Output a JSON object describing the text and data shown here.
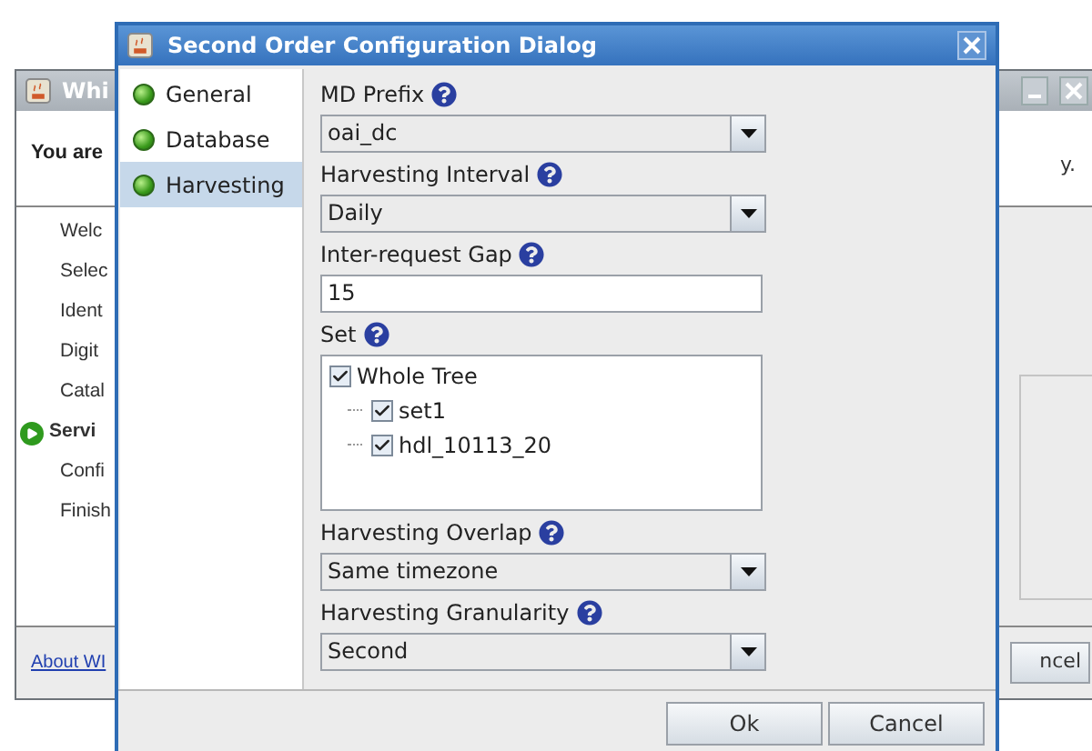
{
  "background_window": {
    "title": "Whi",
    "heading": "You are",
    "steps": [
      {
        "label": "Welc",
        "current": false
      },
      {
        "label": "Selec",
        "current": false
      },
      {
        "label": "Ident",
        "current": false
      },
      {
        "label": "Digit",
        "current": false
      },
      {
        "label": "Catal",
        "current": false
      },
      {
        "label": "Servi",
        "current": true
      },
      {
        "label": "Confi",
        "current": false
      },
      {
        "label": "Finish",
        "current": false
      }
    ],
    "trailing_text": "y.",
    "link": "About WI",
    "button": "ncel"
  },
  "dialog": {
    "title": "Second Order Configuration Dialog",
    "nav": [
      {
        "label": "General",
        "selected": false
      },
      {
        "label": "Database",
        "selected": false
      },
      {
        "label": "Harvesting",
        "selected": true
      }
    ],
    "fields": [
      {
        "kind": "dropdown",
        "label": "MD Prefix",
        "value": "oai_dc"
      },
      {
        "kind": "dropdown",
        "label": "Harvesting Interval",
        "value": "Daily"
      },
      {
        "kind": "text",
        "label": "Inter-request Gap",
        "value": "15"
      },
      {
        "kind": "tree",
        "label": "Set",
        "tree": [
          {
            "label": "Whole Tree",
            "checked": true,
            "children": [
              {
                "label": "set1",
                "checked": true
              },
              {
                "label": "hdl_10113_20",
                "checked": true
              }
            ]
          }
        ]
      },
      {
        "kind": "dropdown",
        "label": "Harvesting Overlap",
        "value": "Same timezone"
      },
      {
        "kind": "dropdown",
        "label": "Harvesting Granularity",
        "value": "Second"
      }
    ],
    "buttons": [
      "Ok",
      "Cancel"
    ]
  }
}
